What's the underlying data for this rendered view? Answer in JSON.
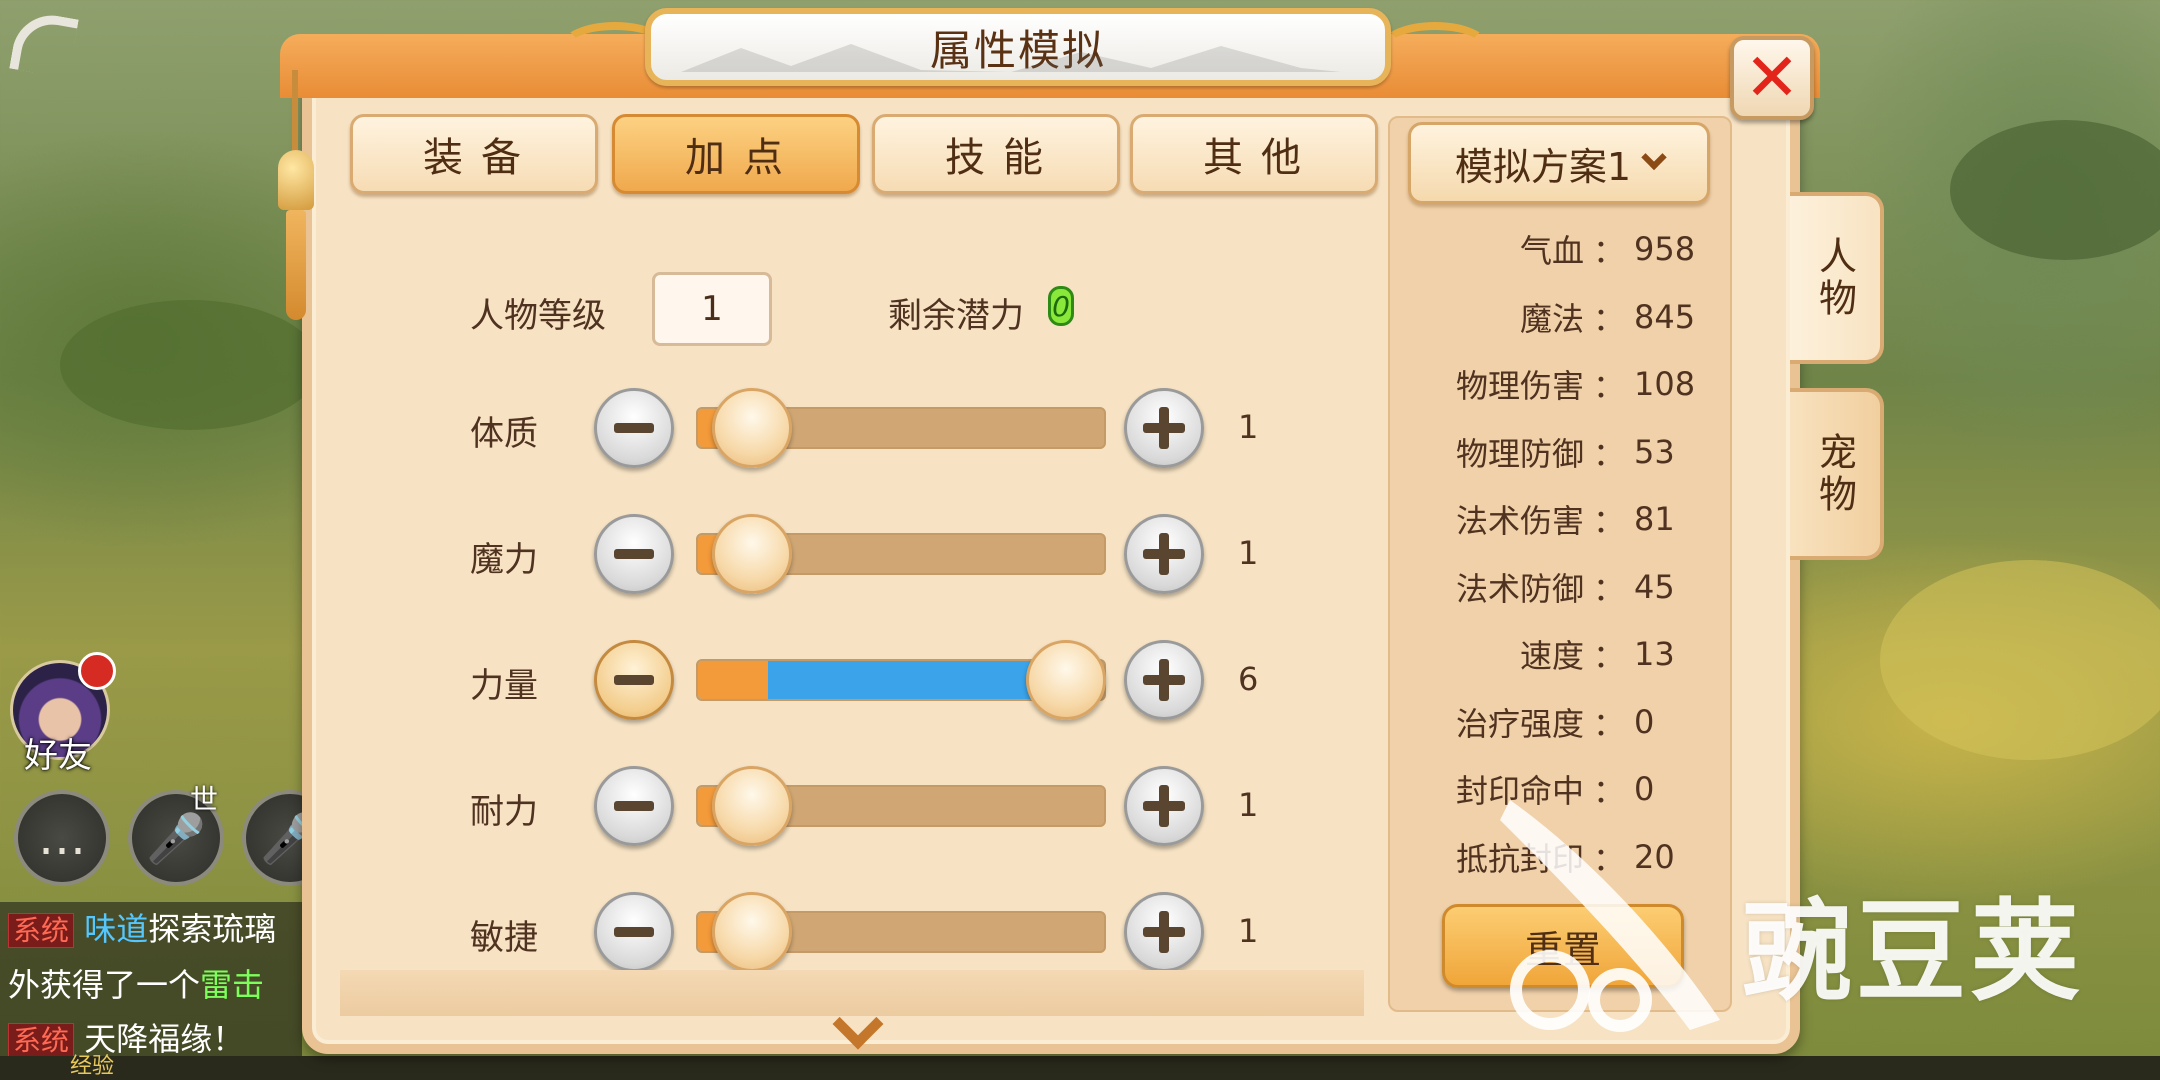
{
  "window": {
    "title": "属性模拟"
  },
  "tabs": [
    {
      "label": "装备",
      "active": false
    },
    {
      "label": "加点",
      "active": true
    },
    {
      "label": "技能",
      "active": false
    },
    {
      "label": "其他",
      "active": false
    }
  ],
  "level": {
    "label": "人物等级",
    "value": "1"
  },
  "potential": {
    "label": "剩余潜力",
    "value": "0"
  },
  "attributes": [
    {
      "label": "体质",
      "value": "1",
      "fill_percent": 3
    },
    {
      "label": "魔力",
      "value": "1",
      "fill_percent": 3
    },
    {
      "label": "力量",
      "value": "6",
      "fill_percent": 100
    },
    {
      "label": "耐力",
      "value": "1",
      "fill_percent": 3
    },
    {
      "label": "敏捷",
      "value": "1",
      "fill_percent": 3
    }
  ],
  "plan": {
    "label": "模拟方案1"
  },
  "stats": [
    {
      "name": "气血",
      "value": "958"
    },
    {
      "name": "魔法",
      "value": "845"
    },
    {
      "name": "物理伤害",
      "value": "108"
    },
    {
      "name": "物理防御",
      "value": "53"
    },
    {
      "name": "法术伤害",
      "value": "81"
    },
    {
      "name": "法术防御",
      "value": "45"
    },
    {
      "name": "速度",
      "value": "13"
    },
    {
      "name": "治疗强度",
      "value": "0"
    },
    {
      "name": "封印命中",
      "value": "0"
    },
    {
      "name": "抵抗封印",
      "value": "20"
    }
  ],
  "colon": "：",
  "reset_label": "重置",
  "side_tabs": [
    {
      "label": "人物",
      "active": true
    },
    {
      "label": "宠物",
      "active": false
    }
  ],
  "hud": {
    "friend_label": "好友",
    "world_label": "世",
    "chat": {
      "line1_tag": "系统",
      "line1_name": "味道",
      "line1_text": "探索琉璃",
      "line2_text": "外获得了一个",
      "line2_item": "雷击",
      "line3_tag": "系统",
      "line3_text": "天降福缘！"
    },
    "xp_label": "经验"
  },
  "watermark": "豌豆荚",
  "colors": {
    "panel": "#f7e3c4",
    "tab_active": "#f0a94d",
    "slider_blue": "#3aa3ea",
    "slider_orange": "#f39a3a",
    "close_red": "#e2241b"
  }
}
